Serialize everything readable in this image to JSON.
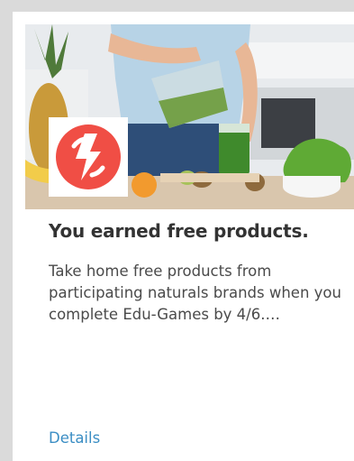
{
  "card": {
    "title": "You earned free products.",
    "description": "Take home free products from participating naturals brands when you complete Edu-Games by 4/6.…",
    "details_label": "Details",
    "hero_image": "woman-pouring-green-smoothie-photo",
    "logo_icon": "lightning-bolt-icon",
    "colors": {
      "logo_red": "#f04e45",
      "link_blue": "#3b8ec4",
      "title_text": "#333333",
      "body_text": "#4a4a4a"
    }
  }
}
